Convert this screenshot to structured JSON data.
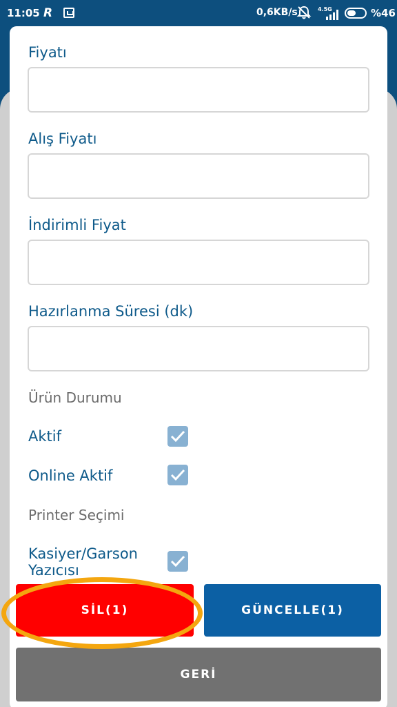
{
  "status_bar": {
    "time": "11:05",
    "app_icon_r": "R",
    "network_speed": "0,6KB/s",
    "signal_type": "4.5G",
    "battery": "%46"
  },
  "form": {
    "price_label": "Fiyatı",
    "price_value": "",
    "purchase_price_label": "Alış Fiyatı",
    "purchase_price_value": "",
    "discount_price_label": "İndirimli Fiyat",
    "discount_price_value": "",
    "prep_time_label": "Hazırlanma Süresi (dk)",
    "prep_time_value": ""
  },
  "product_status": {
    "title": "Ürün Durumu",
    "active_label": "Aktif",
    "active_checked": true,
    "online_active_label": "Online Aktif",
    "online_active_checked": true
  },
  "printer": {
    "title": "Printer Seçimi",
    "cashier_waiter_label": "Kasiyer/Garson Yazıcısı",
    "cashier_waiter_checked": true
  },
  "actions": {
    "delete_label": "SİL(1)",
    "update_label": "GÜNCELLE(1)",
    "back_label": "GERİ"
  },
  "colors": {
    "header": "#0d4f7e",
    "delete": "#ff0000",
    "update": "#0c60a4",
    "back": "#717171",
    "highlight": "#f4a60f",
    "label": "#0e5a8a"
  }
}
